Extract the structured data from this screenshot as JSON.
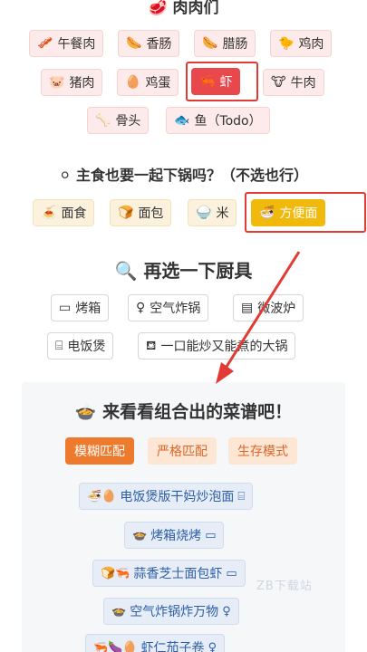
{
  "meat_section": {
    "title_icon": "🥩",
    "title": "肉肉们",
    "items": [
      {
        "icon": "🥓",
        "label": "午餐肉"
      },
      {
        "icon": "🌭",
        "label": "香肠"
      },
      {
        "icon": "🌭",
        "label": "腊肠"
      },
      {
        "icon": "🐤",
        "label": "鸡肉"
      },
      {
        "icon": "🐷",
        "label": "猪肉"
      },
      {
        "icon": "🥚",
        "label": "鸡蛋"
      },
      {
        "icon": "🦐",
        "label": "虾"
      },
      {
        "icon": "🐮",
        "label": "牛肉"
      },
      {
        "icon": "🦴",
        "label": "骨头"
      },
      {
        "icon": "🐟",
        "label": "鱼（Todo）"
      }
    ]
  },
  "staple_section": {
    "title_icon": "⚪",
    "title": "主食也要一起下锅吗？（不选也行）",
    "items": [
      {
        "icon": "🍝",
        "label": "面食"
      },
      {
        "icon": "🍞",
        "label": "面包"
      },
      {
        "icon": "🍚",
        "label": "米"
      },
      {
        "icon": "🍜",
        "label": "方便面"
      }
    ]
  },
  "tools_section": {
    "title_icon": "🔍",
    "title": "再选一下厨具",
    "items": [
      {
        "icon": "▭",
        "label": "烤箱"
      },
      {
        "icon": "♀",
        "label": "空气炸锅"
      },
      {
        "icon": "▤",
        "label": "微波炉"
      },
      {
        "icon": "⌸",
        "label": "电饭煲"
      },
      {
        "icon": "⛾",
        "label": "一口能炒又能煮的大锅"
      }
    ]
  },
  "recipe_section": {
    "title_icon": "🍲",
    "title": "来看看组合出的菜谱吧！",
    "modes": [
      "模糊匹配",
      "严格匹配",
      "生存模式"
    ],
    "recipes": [
      {
        "icons": "🍜🥚",
        "label": "电饭煲版干妈炒泡面",
        "tool_icon": "⌸"
      },
      {
        "icons": "🍲",
        "label": "烤箱烧烤",
        "tool_icon": "▭"
      },
      {
        "icons": "🍞🦐",
        "label": "蒜香芝士面包虾",
        "tool_icon": "▭"
      },
      {
        "icons": "🍲",
        "label": "空气炸锅炸万物",
        "tool_icon": "♀"
      },
      {
        "icons": "🦐🍆🥚",
        "label": "虾仁茄子卷",
        "tool_icon": "♀"
      }
    ]
  },
  "watermark": "ZB下载站",
  "colors": {
    "meat_active": "#e8474b",
    "staple_active": "#f0b90b",
    "highlight": "#e23b35",
    "mode_active": "#ee7a2e"
  }
}
